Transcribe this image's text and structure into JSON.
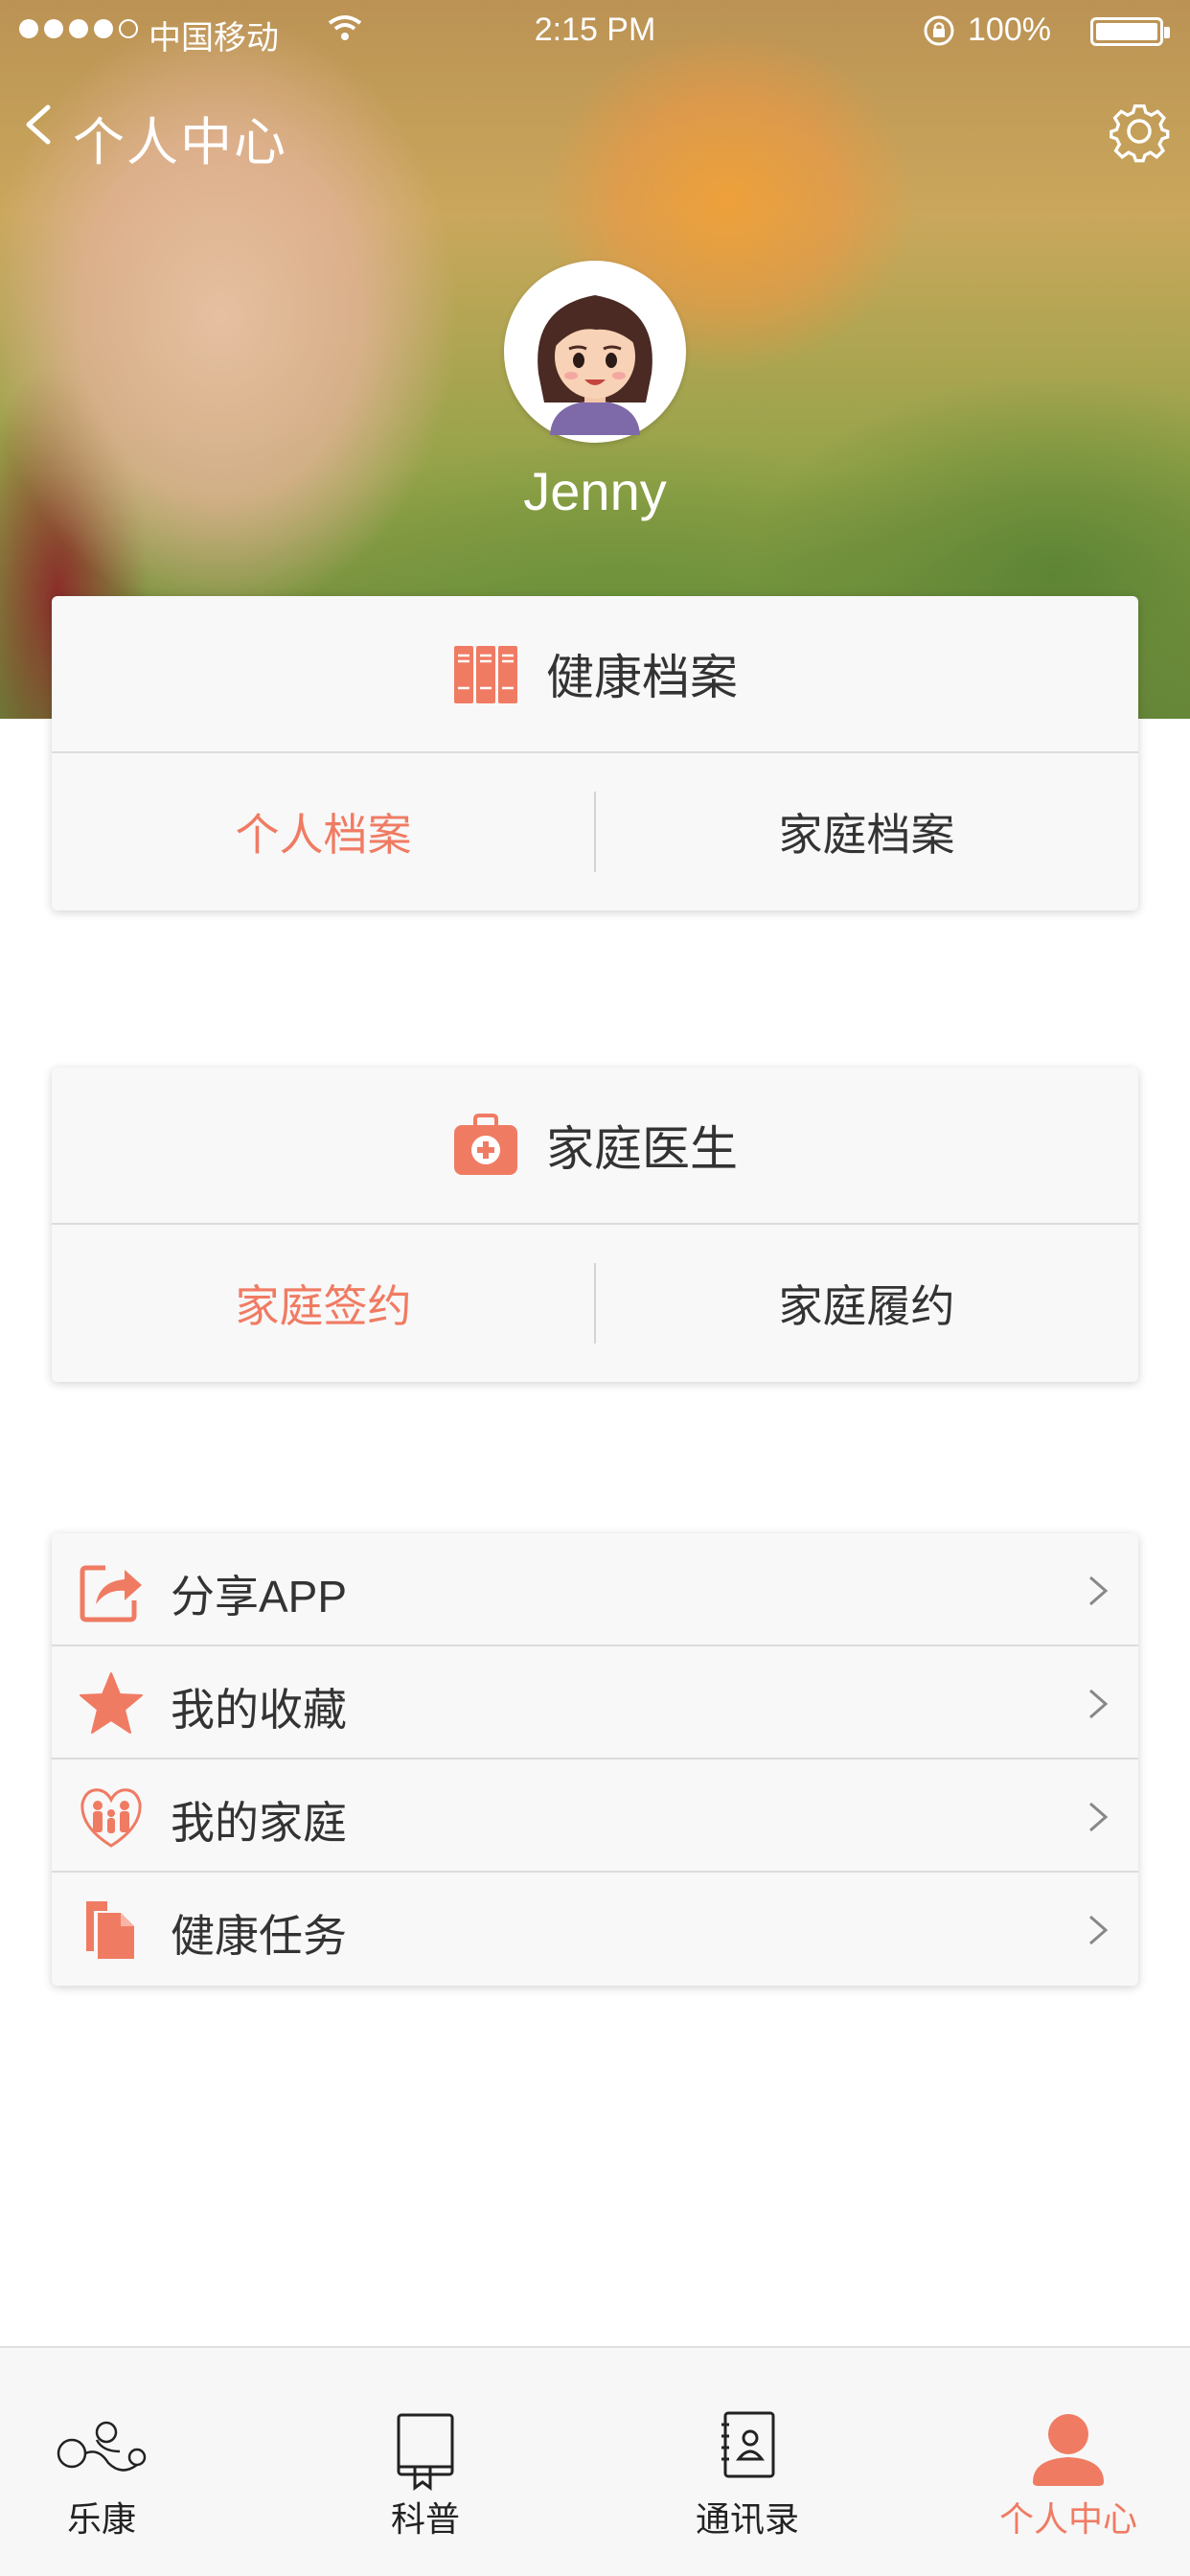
{
  "status_bar": {
    "carrier": "中国移动",
    "time": "2:15 PM",
    "battery": "100%"
  },
  "nav": {
    "title": "个人中心"
  },
  "profile": {
    "username": "Jenny"
  },
  "health_records": {
    "title": "健康档案",
    "icon": "binders-icon",
    "tabs": [
      "个人档案",
      "家庭档案"
    ],
    "active_tab": "个人档案"
  },
  "family_doctor": {
    "title": "家庭医生",
    "icon": "medical-kit-icon",
    "tabs": [
      "家庭签约",
      "家庭履约"
    ],
    "active_tab": "家庭签约"
  },
  "menu": {
    "items": [
      {
        "label": "分享APP",
        "icon": "share-icon"
      },
      {
        "label": "我的收藏",
        "icon": "star-icon"
      },
      {
        "label": "我的家庭",
        "icon": "family-icon"
      },
      {
        "label": "健康任务",
        "icon": "documents-icon"
      }
    ]
  },
  "tabbar": {
    "items": [
      {
        "label": "乐康",
        "icon": "lekang-icon"
      },
      {
        "label": "科普",
        "icon": "book-icon"
      },
      {
        "label": "通讯录",
        "icon": "contacts-icon"
      },
      {
        "label": "个人中心",
        "icon": "person-icon"
      }
    ],
    "active": "个人中心"
  },
  "colors": {
    "accent": "#f07b63",
    "card_bg": "#f8f8f8",
    "text": "#333333"
  }
}
